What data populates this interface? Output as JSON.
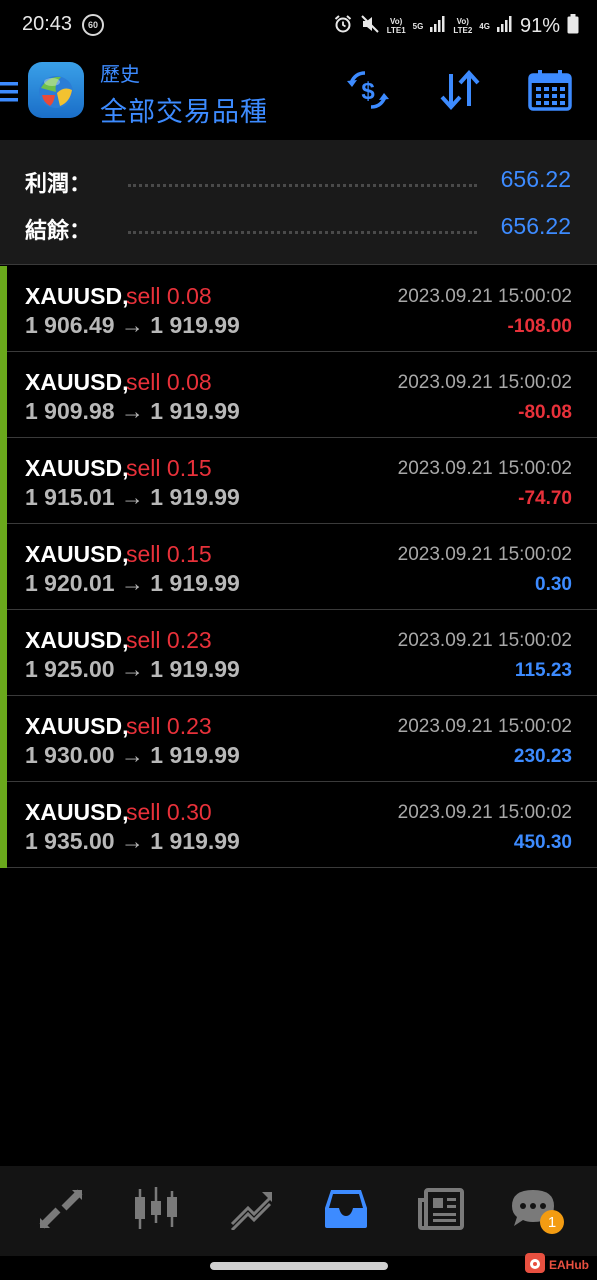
{
  "status_bar": {
    "time": "20:43",
    "indicator": "60",
    "net1_top": "Vo)",
    "net1_bottom": "LTE1",
    "net1_gen": "5G",
    "net2_top": "Vo)",
    "net2_bottom": "LTE2",
    "net2_gen": "4G",
    "battery": "91%"
  },
  "header": {
    "subtitle": "歷史",
    "title": "全部交易品種",
    "icons": [
      "menu-icon",
      "dollar-refresh-icon",
      "sort-icon",
      "calendar-icon"
    ]
  },
  "summary": {
    "profit_label": "利潤：",
    "profit_value": "656.22",
    "balance_label": "結餘：",
    "balance_value": "656.22"
  },
  "trades": [
    {
      "symbol": "XAUUSD,",
      "side": "sell 0.08",
      "prices": "1 906.49 → 1 919.99",
      "time": "2023.09.21 15:00:02",
      "profit": "-108.00"
    },
    {
      "symbol": "XAUUSD,",
      "side": "sell 0.08",
      "prices": "1 909.98 → 1 919.99",
      "time": "2023.09.21 15:00:02",
      "profit": "-80.08"
    },
    {
      "symbol": "XAUUSD,",
      "side": "sell 0.15",
      "prices": "1 915.01 → 1 919.99",
      "time": "2023.09.21 15:00:02",
      "profit": "-74.70"
    },
    {
      "symbol": "XAUUSD,",
      "side": "sell 0.15",
      "prices": "1 920.01 → 1 919.99",
      "time": "2023.09.21 15:00:02",
      "profit": "0.30"
    },
    {
      "symbol": "XAUUSD,",
      "side": "sell 0.23",
      "prices": "1 925.00 → 1 919.99",
      "time": "2023.09.21 15:00:02",
      "profit": "115.23"
    },
    {
      "symbol": "XAUUSD,",
      "side": "sell 0.23",
      "prices": "1 930.00 → 1 919.99",
      "time": "2023.09.21 15:00:02",
      "profit": "230.23"
    },
    {
      "symbol": "XAUUSD,",
      "side": "sell 0.30",
      "prices": "1 935.00 → 1 919.99",
      "time": "2023.09.21 15:00:02",
      "profit": "450.30"
    }
  ],
  "bottom_nav": {
    "items": [
      "quotes-icon",
      "chart-icon",
      "trade-icon",
      "history-icon",
      "news-icon",
      "messages-icon"
    ],
    "active": "history-icon",
    "messages_badge": "1"
  },
  "watermark": {
    "text": "EAHub"
  },
  "colors": {
    "accent": "#3d8bff",
    "loss": "#e8313a",
    "sell": "#e8313a",
    "trade_bar": "#6aa91c"
  }
}
